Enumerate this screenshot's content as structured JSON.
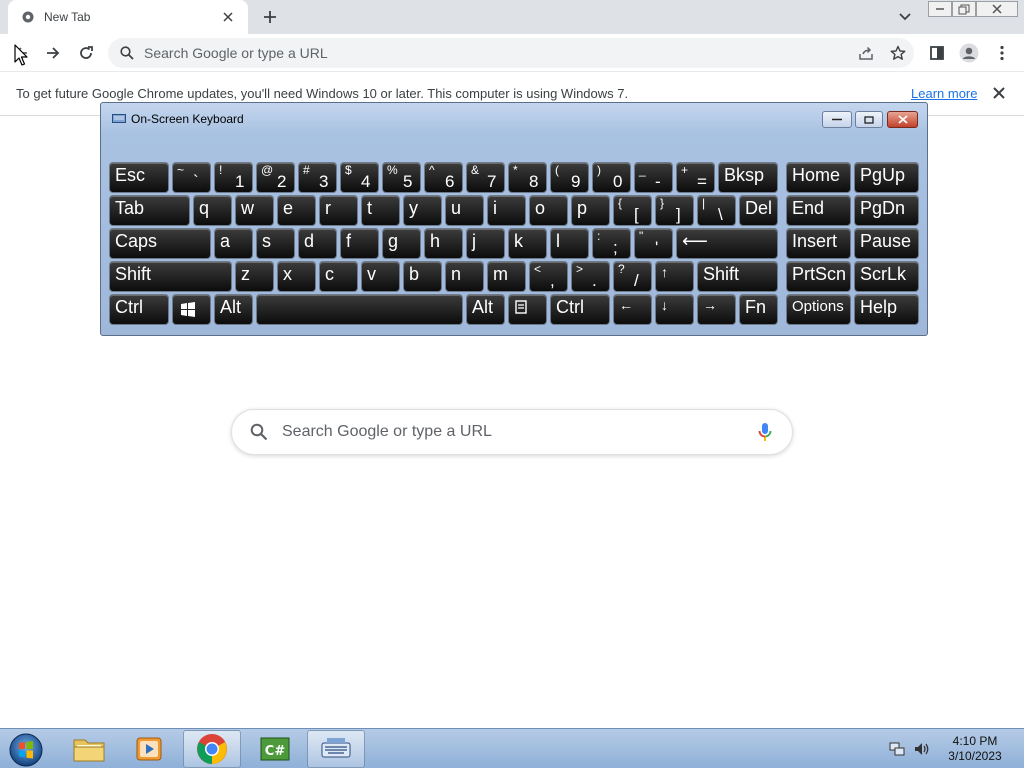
{
  "browser": {
    "tab": {
      "title": "New Tab"
    },
    "omnibox": {
      "placeholder": "Search Google or type a URL"
    },
    "infobar": {
      "message": "To get future Google Chrome updates, you'll need Windows 10 or later. This computer is using Windows 7.",
      "link": "Learn more"
    },
    "ntp_search": {
      "placeholder": "Search Google or type a URL"
    }
  },
  "osk": {
    "title": "On-Screen Keyboard",
    "rows": [
      [
        {
          "id": "esc",
          "main": "Esc"
        },
        {
          "id": "tilde",
          "top": "~",
          "bottom": "`"
        },
        {
          "id": "1",
          "top": "!",
          "bottom": "1"
        },
        {
          "id": "2",
          "top": "@",
          "bottom": "2"
        },
        {
          "id": "3",
          "top": "#",
          "bottom": "3"
        },
        {
          "id": "4",
          "top": "$",
          "bottom": "4"
        },
        {
          "id": "5",
          "top": "%",
          "bottom": "5"
        },
        {
          "id": "6",
          "top": "^",
          "bottom": "6"
        },
        {
          "id": "7",
          "top": "&",
          "bottom": "7"
        },
        {
          "id": "8",
          "top": "*",
          "bottom": "8"
        },
        {
          "id": "9",
          "top": "(",
          "bottom": "9"
        },
        {
          "id": "0",
          "top": ")",
          "bottom": "0"
        },
        {
          "id": "minus",
          "top": "_",
          "bottom": "-"
        },
        {
          "id": "equals",
          "top": "+",
          "bottom": "="
        },
        {
          "id": "bksp",
          "main": "Bksp"
        },
        {
          "id": "home",
          "main": "Home"
        },
        {
          "id": "pgup",
          "main": "PgUp"
        }
      ],
      [
        {
          "id": "tab",
          "main": "Tab"
        },
        {
          "id": "q",
          "main": "q"
        },
        {
          "id": "w",
          "main": "w"
        },
        {
          "id": "e",
          "main": "e"
        },
        {
          "id": "r",
          "main": "r"
        },
        {
          "id": "t",
          "main": "t"
        },
        {
          "id": "y",
          "main": "y"
        },
        {
          "id": "u",
          "main": "u"
        },
        {
          "id": "i",
          "main": "i"
        },
        {
          "id": "o",
          "main": "o"
        },
        {
          "id": "p",
          "main": "p"
        },
        {
          "id": "lbracket",
          "top": "{",
          "bottom": "["
        },
        {
          "id": "rbracket",
          "top": "}",
          "bottom": "]"
        },
        {
          "id": "backslash",
          "top": "|",
          "bottom": "\\"
        },
        {
          "id": "del",
          "main": "Del"
        },
        {
          "id": "end",
          "main": "End"
        },
        {
          "id": "pgdn",
          "main": "PgDn"
        }
      ],
      [
        {
          "id": "caps",
          "main": "Caps"
        },
        {
          "id": "a",
          "main": "a"
        },
        {
          "id": "s",
          "main": "s"
        },
        {
          "id": "d",
          "main": "d"
        },
        {
          "id": "f",
          "main": "f"
        },
        {
          "id": "g",
          "main": "g"
        },
        {
          "id": "h",
          "main": "h"
        },
        {
          "id": "j",
          "main": "j"
        },
        {
          "id": "k",
          "main": "k"
        },
        {
          "id": "l",
          "main": "l"
        },
        {
          "id": "semicolon",
          "top": ":",
          "bottom": ";"
        },
        {
          "id": "quote",
          "top": "\"",
          "bottom": "'"
        },
        {
          "id": "enter",
          "main": "⟵"
        },
        {
          "id": "insert",
          "main": "Insert"
        },
        {
          "id": "pause",
          "main": "Pause"
        }
      ],
      [
        {
          "id": "lshift",
          "main": "Shift"
        },
        {
          "id": "z",
          "main": "z"
        },
        {
          "id": "x",
          "main": "x"
        },
        {
          "id": "c",
          "main": "c"
        },
        {
          "id": "v",
          "main": "v"
        },
        {
          "id": "b",
          "main": "b"
        },
        {
          "id": "n",
          "main": "n"
        },
        {
          "id": "m",
          "main": "m"
        },
        {
          "id": "comma",
          "top": "<",
          "bottom": ","
        },
        {
          "id": "period",
          "top": ">",
          "bottom": "."
        },
        {
          "id": "slash",
          "top": "?",
          "bottom": "/"
        },
        {
          "id": "up",
          "main": "↑"
        },
        {
          "id": "rshift",
          "main": "Shift"
        },
        {
          "id": "prtscn",
          "main": "PrtScn"
        },
        {
          "id": "scrlk",
          "main": "ScrLk"
        }
      ],
      [
        {
          "id": "lctrl",
          "main": "Ctrl"
        },
        {
          "id": "win",
          "main": ""
        },
        {
          "id": "lalt",
          "main": "Alt"
        },
        {
          "id": "space",
          "main": ""
        },
        {
          "id": "ralt",
          "main": "Alt"
        },
        {
          "id": "menu",
          "main": ""
        },
        {
          "id": "rctrl",
          "main": "Ctrl"
        },
        {
          "id": "left",
          "main": "←"
        },
        {
          "id": "down",
          "main": "↓"
        },
        {
          "id": "right",
          "main": "→"
        },
        {
          "id": "fn",
          "main": "Fn"
        },
        {
          "id": "options",
          "main": "Options"
        },
        {
          "id": "help",
          "main": "Help"
        }
      ]
    ]
  },
  "taskbar": {
    "items": [
      "start-button",
      "windows-explorer",
      "media-player",
      "google-chrome",
      "csharp-app",
      "on-screen-keyboard"
    ],
    "time": "4:10 PM",
    "date": "3/10/2023"
  }
}
